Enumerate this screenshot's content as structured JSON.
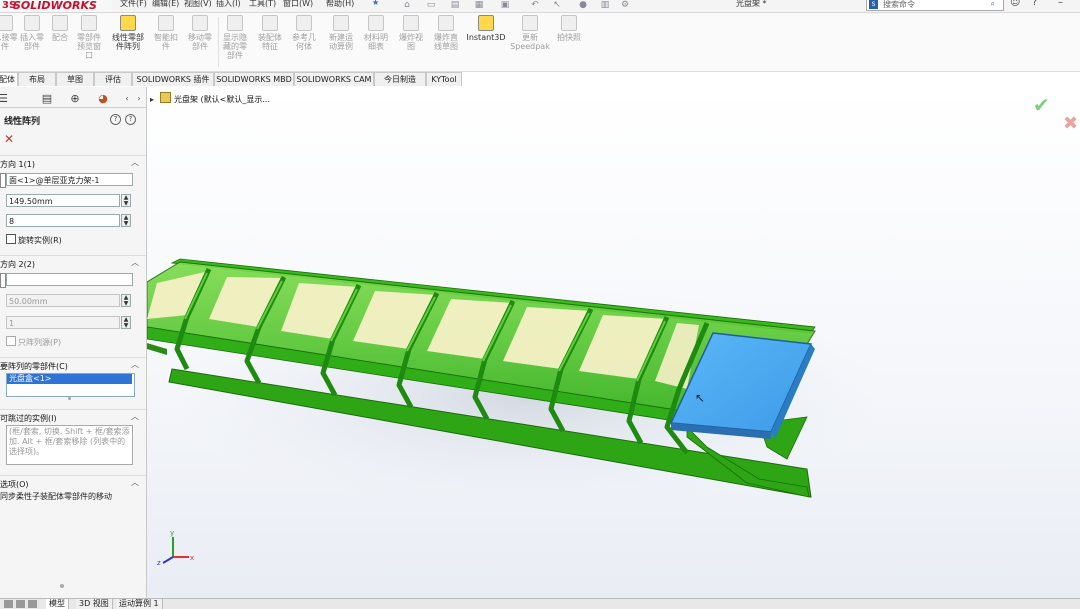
{
  "app": {
    "brand": "SOLIDWORKS",
    "brand_prefix": "3S"
  },
  "menu": {
    "items": [
      "文件(F)",
      "编辑(E)",
      "视图(V)",
      "插入(I)",
      "工具(T)",
      "窗口(W)",
      "帮助(H)"
    ],
    "pin": "★",
    "document_name": "光盘架 *"
  },
  "search": {
    "placeholder": "搜索命令"
  },
  "ribbon": {
    "buttons": [
      {
        "label": "...接零\n件"
      },
      {
        "label": "插入零\n部件"
      },
      {
        "label": "配合"
      },
      {
        "label": "零部件\n预览窗\n口"
      },
      {
        "label": "线性零部\n件阵列"
      },
      {
        "label": "智能扣\n件"
      },
      {
        "label": "移动零\n部件"
      },
      {
        "label": "显示隐\n藏的零\n部件"
      },
      {
        "label": "装配体\n特征"
      },
      {
        "label": "参考几\n何体"
      },
      {
        "label": "新建运\n动算例"
      },
      {
        "label": "材料明\n细表"
      },
      {
        "label": "爆炸视\n图"
      },
      {
        "label": "爆炸直\n线草图"
      },
      {
        "label": "Instant3D"
      },
      {
        "label": "更新\nSpeedpak"
      },
      {
        "label": "拍快照"
      }
    ]
  },
  "tabs": [
    {
      "label": "装配体"
    },
    {
      "label": "布局"
    },
    {
      "label": "草图"
    },
    {
      "label": "评估"
    },
    {
      "label": "SOLIDWORKS 插件"
    },
    {
      "label": "SOLIDWORKS MBD"
    },
    {
      "label": "SOLIDWORKS CAM"
    },
    {
      "label": "今日制造"
    },
    {
      "label": "KYTool"
    }
  ],
  "panel": {
    "title": "线性阵列",
    "help1": "?",
    "help2": "?",
    "direction1": {
      "header": "方向 1(1)",
      "edge": "面<1>@单层亚克力架-1",
      "spacing": "149.50mm",
      "instances": "8",
      "rotate_label": "旋转实例(R)"
    },
    "direction2": {
      "header": "方向 2(2)",
      "edge": "",
      "spacing": "50.00mm",
      "instances": "1",
      "seed_only_label": "只阵列源(P)"
    },
    "components": {
      "header": "要阵列的零部件(C)",
      "selected": "光盘盒<1>"
    },
    "skip": {
      "header": "可跳过的实例(I)",
      "hint": "(框/套索, 切换. Shift + 框/套索添加. Alt + 框/套索移除 (列表中的选择项)。"
    },
    "options": {
      "header": "选项(O)",
      "sync_label": "同步柔性子装配体零部件的移动"
    }
  },
  "tree": {
    "root_label": "光盘架 (默认<默认_显示..."
  },
  "bottom_tabs": [
    {
      "label": "模型"
    },
    {
      "label": "3D 视图"
    },
    {
      "label": "运动算例 1"
    }
  ],
  "triad": {
    "x": "x",
    "y": "y",
    "z": "z"
  },
  "colors": {
    "rack_green": "#38b81f",
    "rack_green_dark": "#1f8a10",
    "preview_yellow": "#f4eec0",
    "box_blue": "#4aa9f0",
    "selection_blue": "#2f73d6",
    "brand_red": "#c8102e"
  }
}
